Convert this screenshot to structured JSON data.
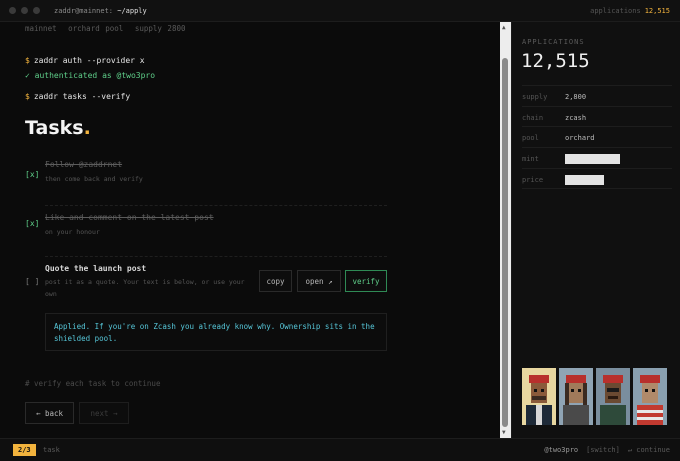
{
  "window": {
    "title_host": "zaddr@mainnet:",
    "title_path": "~/apply",
    "applications_label": "applications",
    "applications_count": "12,515"
  },
  "status_line": [
    "mainnet",
    "orchard pool",
    "supply 2800"
  ],
  "terminal": {
    "prompt_symbol": "$",
    "cmd_auth": "zaddr auth --provider x",
    "auth_result": "✓ authenticated as @two3pro",
    "cmd_tasks": "zaddr tasks --verify"
  },
  "tasks_heading": {
    "text": "Tasks",
    "accent": "."
  },
  "tasks": [
    {
      "check": "[x]",
      "title": "Follow @zaddrnet",
      "subtitle": "then come back and verify",
      "done": true
    },
    {
      "check": "[x]",
      "title": "Like and comment on the latest post",
      "subtitle": "on your honour",
      "done": true
    },
    {
      "check": "[ ]",
      "title": "Quote the launch post",
      "subtitle": "post it as a quote. Your text is below, or use your own",
      "done": false
    }
  ],
  "task_actions": {
    "copy": "copy",
    "open": "open ↗",
    "verify": "verify"
  },
  "quote_text": "Applied. If you're on Zcash you already know why. Ownership sits in the shielded pool.",
  "hint": "# verify each task to continue",
  "nav": {
    "back": "← back",
    "next": "next →"
  },
  "sidebar": {
    "label": "APPLICATIONS",
    "count": "12,515",
    "rows": [
      {
        "key": "supply",
        "value": "2,800"
      },
      {
        "key": "chain",
        "value": "zcash"
      },
      {
        "key": "pool",
        "value": "orchard"
      },
      {
        "key": "mint",
        "value": ""
      },
      {
        "key": "price",
        "value": ""
      }
    ],
    "avatars": [
      "nft-avatar-1",
      "nft-avatar-2",
      "nft-avatar-3",
      "nft-avatar-4"
    ]
  },
  "footer": {
    "progress": "2/3",
    "section": "task",
    "handle": "@two3pro",
    "switch": "[switch]",
    "continue": "↵ continue"
  },
  "colors": {
    "accent": "#f2b33d",
    "success": "#5fcf8a",
    "quote": "#56c6d8",
    "background": "#0b0b0b"
  }
}
